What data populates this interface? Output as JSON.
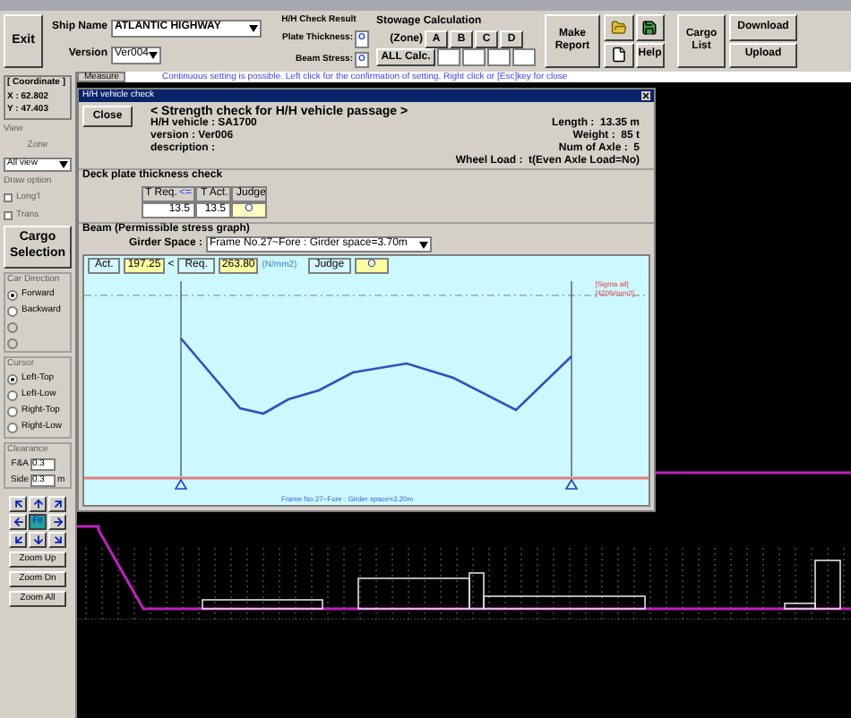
{
  "toolbar": {
    "exit": "Exit",
    "ship_name_label": "Ship Name",
    "ship_name": "ATLANTIC HIGHWAY",
    "version_label": "Version",
    "version": "Ver004",
    "check_result": {
      "title": "H/H Check Result",
      "plate_label": "Plate Thickness:",
      "plate_value": "O",
      "beam_label": "Beam Stress:",
      "beam_value": "O"
    },
    "stowage": {
      "title": "Stowage Calculation",
      "zone_label": "(Zone)",
      "zones": [
        "A",
        "B",
        "C",
        "D"
      ],
      "all_calc": "ALL Calc."
    },
    "make_report": "Make Report",
    "help": "Help",
    "cargo_list": "Cargo List",
    "download": "Download",
    "upload": "Upload"
  },
  "message_bar": {
    "tab": "Measure",
    "message": "Continuous setting is possible. Left click for the confirmation of setting. Right click or [Esc]key for close"
  },
  "left_panel": {
    "coordinate_title": "[ Coordinate ]",
    "x": "X : 62.802",
    "y": "Y : 47.403",
    "view_title": "View",
    "zone_label": "Zone",
    "zone_value": "All view",
    "draw_option_label": "Draw option",
    "draw_options": [
      {
        "label": "Long'l",
        "checked": false
      },
      {
        "label": "Trans",
        "checked": false
      }
    ],
    "cargo_selection": "Cargo Selection",
    "car_direction_label": "Car Direction",
    "car_directions": [
      {
        "label": "Forward",
        "selected": true,
        "disabled": false
      },
      {
        "label": "Backward",
        "selected": false,
        "disabled": false
      },
      {
        "selected": false,
        "disabled": true
      },
      {
        "selected": false,
        "disabled": true
      }
    ],
    "cursor_label": "Cursor",
    "cursors": [
      {
        "label": "Left-Top",
        "selected": true
      },
      {
        "label": "Left-Low",
        "selected": false
      },
      {
        "label": "Right-Top",
        "selected": false
      },
      {
        "label": "Right-Low",
        "selected": false
      }
    ],
    "clearance_label": "Clearance",
    "fa_label": "F&A",
    "fa_value": "0.3",
    "side_label": "Side",
    "side_value": "0.3",
    "side_unit": "m",
    "fit": "Fit",
    "zoom_buttons": [
      "Zoom Up",
      "Zoom Dn",
      "Zoom All"
    ]
  },
  "dialog": {
    "title": "H/H vehicle check",
    "close": "Close",
    "heading": "< Strength check for H/H vehicle passage >",
    "info_left": [
      "H/H vehicle : SA1700",
      "version : Ver006",
      "description :"
    ],
    "info_right": [
      "Length :  13.35 m",
      "Weight :  85 t",
      "Num of Axle :  5",
      "Wheel Load :  t(Even Axle Load=No)"
    ],
    "deck_title": "Deck plate thickness check",
    "deck_table": {
      "req_label": "T Req.",
      "op": "<=",
      "act_label": "T Act.",
      "judge_label": "Judge",
      "req": "13.5",
      "act": "13.5",
      "judge": "O"
    },
    "beam_title": "Beam (Permissible stress graph)",
    "girder_label": "Girder Space :",
    "girder_value": "Frame No.27~Fore : Girder space=3.70m",
    "beam_result": {
      "act_label": "Act.",
      "act": "197.25",
      "op": "<",
      "req_label": "Req.",
      "req": "263.80",
      "unit": "(N/mm2)",
      "judge_label": "Judge",
      "judge": "O"
    },
    "graph_label": [
      "[Sigma all]",
      "[420N/mm2]"
    ],
    "graph_caption": "Frame No.27~Fore : Girder space=3.20m"
  }
}
